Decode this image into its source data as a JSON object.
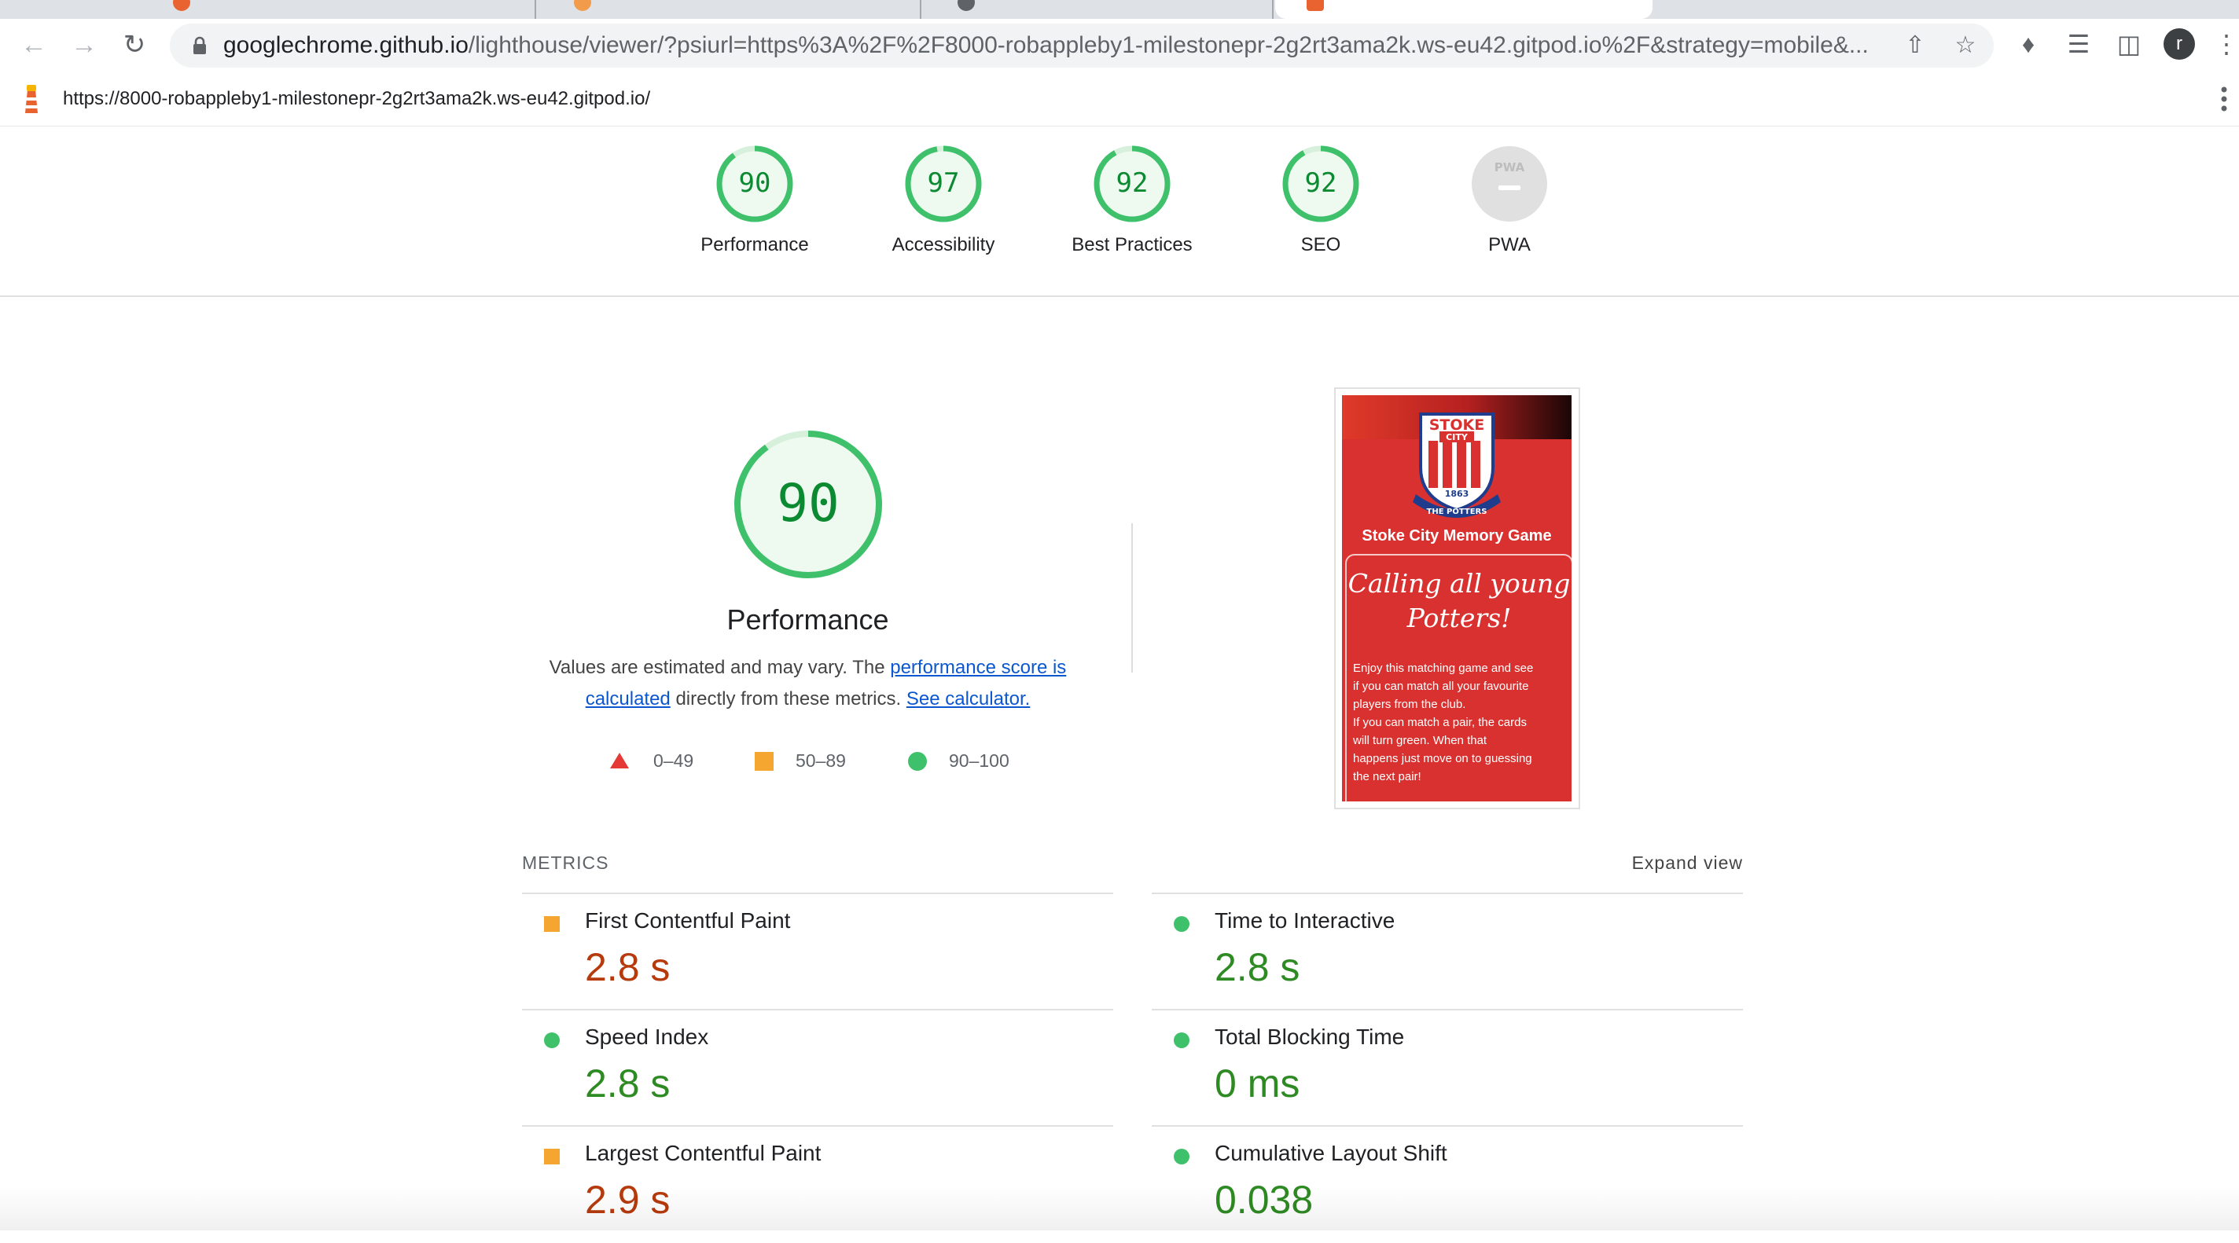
{
  "browser": {
    "address_host": "googlechrome.github.io",
    "address_path": "/lighthouse/viewer/?psiurl=https%3A%2F%2F8000-robappleby1-milestonepr-2g2rt3ama2k.ws-eu42.gitpod.io%2F&strategy=mobile&...",
    "profile_initial": "r"
  },
  "report": {
    "url": "https://8000-robappleby1-milestonepr-2g2rt3ama2k.ws-eu42.gitpod.io/"
  },
  "gauges": [
    {
      "score": "90",
      "value": 90,
      "label": "Performance"
    },
    {
      "score": "97",
      "value": 97,
      "label": "Accessibility"
    },
    {
      "score": "92",
      "value": 92,
      "label": "Best Practices"
    },
    {
      "score": "92",
      "value": 92,
      "label": "SEO"
    },
    {
      "score": "PWA",
      "label": "PWA"
    }
  ],
  "performance": {
    "score": "90",
    "value": 90,
    "title": "Performance",
    "desc_before": "Values are estimated and may vary. The ",
    "desc_link": "performance score is calculated",
    "desc_middle": " directly from these metrics. ",
    "desc_link2": "See calculator."
  },
  "legend": {
    "fail": "0–49",
    "average": "50–89",
    "pass": "90–100"
  },
  "screenshot": {
    "crest_top": "STOKE",
    "crest_city": "CITY",
    "crest_year": "1863",
    "crest_ribbon": "THE POTTERS",
    "title": "Stoke City Memory Game",
    "heading_line1": "Calling all young",
    "heading_line2": "Potters!",
    "body_line1": "Enjoy this matching game and see",
    "body_line2": "if you can match all your favourite",
    "body_line3": "players from the club.",
    "body_line4": "If you can match a pair, the cards",
    "body_line5": "will turn green. When that",
    "body_line6": "happens just move on to guessing",
    "body_line7": "the next pair!"
  },
  "metrics": {
    "header": "METRICS",
    "expand": "Expand view",
    "items": [
      {
        "name": "First Contentful Paint",
        "value": "2.8 s",
        "rating": "average"
      },
      {
        "name": "Time to Interactive",
        "value": "2.8 s",
        "rating": "pass"
      },
      {
        "name": "Speed Index",
        "value": "2.8 s",
        "rating": "pass"
      },
      {
        "name": "Total Blocking Time",
        "value": "0 ms",
        "rating": "pass"
      },
      {
        "name": "Largest Contentful Paint",
        "value": "2.9 s",
        "rating": "average"
      },
      {
        "name": "Cumulative Layout Shift",
        "value": "0.038",
        "rating": "pass"
      }
    ]
  },
  "colors": {
    "pass": "#0c8a31",
    "pass_ring": "#3ec16a",
    "average": "#f4a631",
    "fail": "#e53935",
    "link": "#0b57d0"
  }
}
